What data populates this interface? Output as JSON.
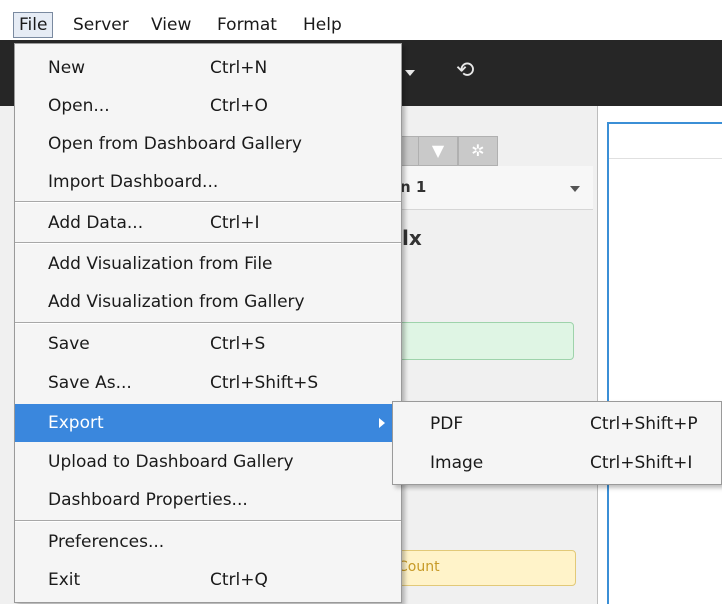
{
  "menubar": {
    "items": [
      "File",
      "Server",
      "View",
      "Format",
      "Help"
    ]
  },
  "toolbar": {
    "dropdown_icon": "caret-down-icon",
    "refresh_icon": "refresh-icon"
  },
  "left_pane": {
    "tab_icons": [
      "filter-icon",
      "gear-icon"
    ],
    "header_title": "n 1",
    "chart_type_icon": "chart-type-icon",
    "green_shelf_text": ")",
    "yellow_shelf_text": "Count"
  },
  "file_menu": {
    "items": [
      {
        "label": "New",
        "shortcut": "Ctrl+N"
      },
      {
        "label": "Open...",
        "shortcut": "Ctrl+O"
      },
      {
        "label": "Open from Dashboard Gallery",
        "shortcut": ""
      },
      {
        "label": "Import Dashboard...",
        "shortcut": ""
      },
      {
        "label": "Add Data...",
        "shortcut": "Ctrl+I"
      },
      {
        "label": "Add Visualization from File",
        "shortcut": ""
      },
      {
        "label": "Add Visualization from Gallery",
        "shortcut": ""
      },
      {
        "label": "Save",
        "shortcut": "Ctrl+S"
      },
      {
        "label": "Save As...",
        "shortcut": "Ctrl+Shift+S"
      },
      {
        "label": "Export",
        "shortcut": ""
      },
      {
        "label": "Upload to Dashboard Gallery",
        "shortcut": ""
      },
      {
        "label": "Dashboard Properties...",
        "shortcut": ""
      },
      {
        "label": "Preferences...",
        "shortcut": ""
      },
      {
        "label": "Exit",
        "shortcut": "Ctrl+Q"
      }
    ]
  },
  "export_submenu": {
    "items": [
      {
        "label": "PDF",
        "shortcut": "Ctrl+Shift+P"
      },
      {
        "label": "Image",
        "shortcut": "Ctrl+Shift+I"
      }
    ]
  },
  "colors": {
    "highlight": "#3a87dd",
    "toolbar": "#262626",
    "canvas_border": "#3b8fd6"
  }
}
